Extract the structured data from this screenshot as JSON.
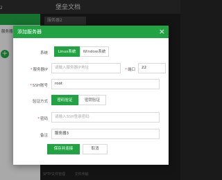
{
  "background": {
    "app_title": "堡垒文档",
    "top_left_number": "2",
    "left_panel_label": "服务器列",
    "tab_label": "服务器2",
    "footer_items": [
      "SFTP文件管理",
      "文件传输"
    ]
  },
  "modal": {
    "title": "添加服务器",
    "close_symbol": "×",
    "system_label": "系统",
    "system_options": [
      "Linux系统",
      "Window系统"
    ],
    "selected_system": "Linux系统",
    "server_ip_label": "服务器IP",
    "server_ip_placeholder": "请输入服务器IP地址",
    "port_label": "端口",
    "port_value": "22",
    "ssh_account_label": "SSH账号",
    "ssh_account_value": "root",
    "auth_method_label": "验证方式",
    "auth_options": [
      "密码验证",
      "密钥验证"
    ],
    "selected_auth": "密码验证",
    "password_label": "密码",
    "password_placeholder": "请输入SSH登录密码",
    "remark_label": "备注",
    "remark_value": "服务器3",
    "save_connect_label": "保存并连接",
    "cancel_label": "取消"
  },
  "colors": {
    "accent": "#21a344",
    "required_marker": "#e04848"
  }
}
